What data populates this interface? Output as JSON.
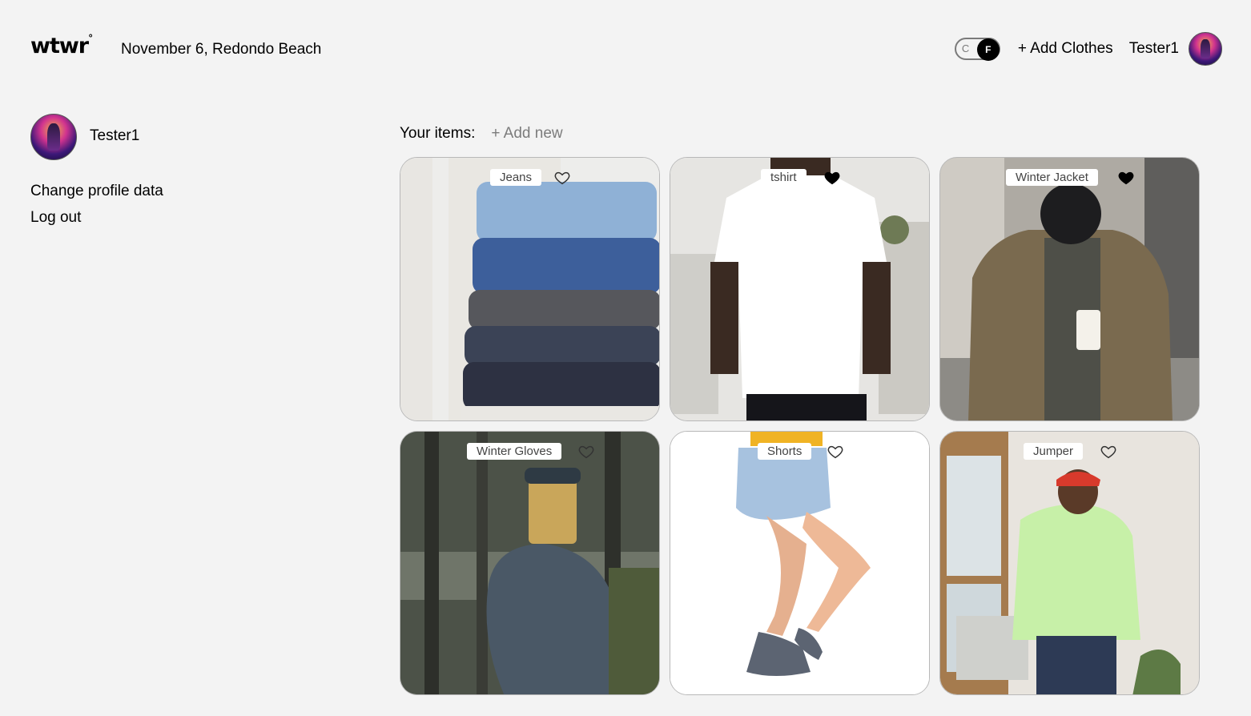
{
  "header": {
    "logo": "wtwr",
    "logo_mark": "°",
    "date_location": "November 6, Redondo Beach",
    "toggle": {
      "left": "C",
      "right": "F",
      "selected": "F"
    },
    "add_clothes": "+ Add Clothes",
    "username": "Tester1"
  },
  "sidebar": {
    "username": "Tester1",
    "change_profile": "Change profile data",
    "logout": "Log out"
  },
  "items": {
    "title": "Your items:",
    "add_new": "+ Add new",
    "cards": [
      {
        "label": "Jeans",
        "liked": false
      },
      {
        "label": "tshirt",
        "liked": true
      },
      {
        "label": "Winter Jacket",
        "liked": true
      },
      {
        "label": "Winter Gloves",
        "liked": false
      },
      {
        "label": "Shorts",
        "liked": false
      },
      {
        "label": "Jumper",
        "liked": false
      }
    ]
  },
  "colors": {
    "background": "#f3f3f3",
    "muted_text": "#7c7c7c",
    "card_border": "#b8b8b8"
  }
}
